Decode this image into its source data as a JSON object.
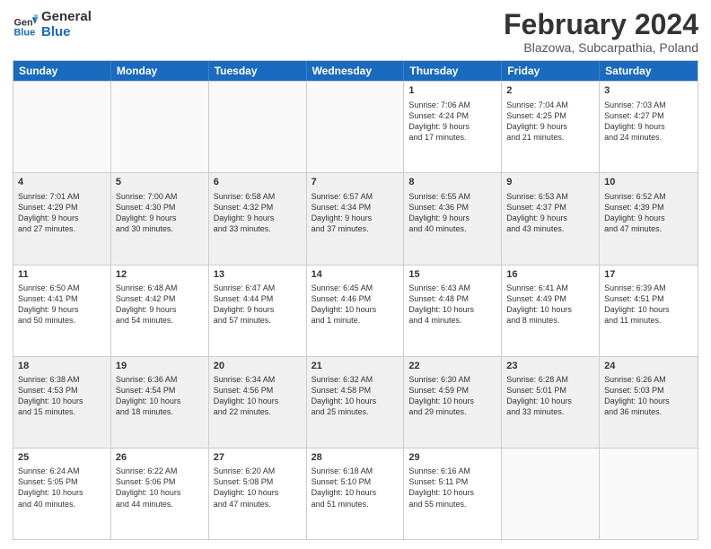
{
  "logo": {
    "line1": "General",
    "line2": "Blue"
  },
  "title": "February 2024",
  "subtitle": "Blazowa, Subcarpathia, Poland",
  "days": [
    "Sunday",
    "Monday",
    "Tuesday",
    "Wednesday",
    "Thursday",
    "Friday",
    "Saturday"
  ],
  "rows": [
    [
      {
        "day": "",
        "lines": []
      },
      {
        "day": "",
        "lines": []
      },
      {
        "day": "",
        "lines": []
      },
      {
        "day": "",
        "lines": []
      },
      {
        "day": "1",
        "lines": [
          "Sunrise: 7:06 AM",
          "Sunset: 4:24 PM",
          "Daylight: 9 hours",
          "and 17 minutes."
        ]
      },
      {
        "day": "2",
        "lines": [
          "Sunrise: 7:04 AM",
          "Sunset: 4:25 PM",
          "Daylight: 9 hours",
          "and 21 minutes."
        ]
      },
      {
        "day": "3",
        "lines": [
          "Sunrise: 7:03 AM",
          "Sunset: 4:27 PM",
          "Daylight: 9 hours",
          "and 24 minutes."
        ]
      }
    ],
    [
      {
        "day": "4",
        "lines": [
          "Sunrise: 7:01 AM",
          "Sunset: 4:29 PM",
          "Daylight: 9 hours",
          "and 27 minutes."
        ]
      },
      {
        "day": "5",
        "lines": [
          "Sunrise: 7:00 AM",
          "Sunset: 4:30 PM",
          "Daylight: 9 hours",
          "and 30 minutes."
        ]
      },
      {
        "day": "6",
        "lines": [
          "Sunrise: 6:58 AM",
          "Sunset: 4:32 PM",
          "Daylight: 9 hours",
          "and 33 minutes."
        ]
      },
      {
        "day": "7",
        "lines": [
          "Sunrise: 6:57 AM",
          "Sunset: 4:34 PM",
          "Daylight: 9 hours",
          "and 37 minutes."
        ]
      },
      {
        "day": "8",
        "lines": [
          "Sunrise: 6:55 AM",
          "Sunset: 4:36 PM",
          "Daylight: 9 hours",
          "and 40 minutes."
        ]
      },
      {
        "day": "9",
        "lines": [
          "Sunrise: 6:53 AM",
          "Sunset: 4:37 PM",
          "Daylight: 9 hours",
          "and 43 minutes."
        ]
      },
      {
        "day": "10",
        "lines": [
          "Sunrise: 6:52 AM",
          "Sunset: 4:39 PM",
          "Daylight: 9 hours",
          "and 47 minutes."
        ]
      }
    ],
    [
      {
        "day": "11",
        "lines": [
          "Sunrise: 6:50 AM",
          "Sunset: 4:41 PM",
          "Daylight: 9 hours",
          "and 50 minutes."
        ]
      },
      {
        "day": "12",
        "lines": [
          "Sunrise: 6:48 AM",
          "Sunset: 4:42 PM",
          "Daylight: 9 hours",
          "and 54 minutes."
        ]
      },
      {
        "day": "13",
        "lines": [
          "Sunrise: 6:47 AM",
          "Sunset: 4:44 PM",
          "Daylight: 9 hours",
          "and 57 minutes."
        ]
      },
      {
        "day": "14",
        "lines": [
          "Sunrise: 6:45 AM",
          "Sunset: 4:46 PM",
          "Daylight: 10 hours",
          "and 1 minute."
        ]
      },
      {
        "day": "15",
        "lines": [
          "Sunrise: 6:43 AM",
          "Sunset: 4:48 PM",
          "Daylight: 10 hours",
          "and 4 minutes."
        ]
      },
      {
        "day": "16",
        "lines": [
          "Sunrise: 6:41 AM",
          "Sunset: 4:49 PM",
          "Daylight: 10 hours",
          "and 8 minutes."
        ]
      },
      {
        "day": "17",
        "lines": [
          "Sunrise: 6:39 AM",
          "Sunset: 4:51 PM",
          "Daylight: 10 hours",
          "and 11 minutes."
        ]
      }
    ],
    [
      {
        "day": "18",
        "lines": [
          "Sunrise: 6:38 AM",
          "Sunset: 4:53 PM",
          "Daylight: 10 hours",
          "and 15 minutes."
        ]
      },
      {
        "day": "19",
        "lines": [
          "Sunrise: 6:36 AM",
          "Sunset: 4:54 PM",
          "Daylight: 10 hours",
          "and 18 minutes."
        ]
      },
      {
        "day": "20",
        "lines": [
          "Sunrise: 6:34 AM",
          "Sunset: 4:56 PM",
          "Daylight: 10 hours",
          "and 22 minutes."
        ]
      },
      {
        "day": "21",
        "lines": [
          "Sunrise: 6:32 AM",
          "Sunset: 4:58 PM",
          "Daylight: 10 hours",
          "and 25 minutes."
        ]
      },
      {
        "day": "22",
        "lines": [
          "Sunrise: 6:30 AM",
          "Sunset: 4:59 PM",
          "Daylight: 10 hours",
          "and 29 minutes."
        ]
      },
      {
        "day": "23",
        "lines": [
          "Sunrise: 6:28 AM",
          "Sunset: 5:01 PM",
          "Daylight: 10 hours",
          "and 33 minutes."
        ]
      },
      {
        "day": "24",
        "lines": [
          "Sunrise: 6:26 AM",
          "Sunset: 5:03 PM",
          "Daylight: 10 hours",
          "and 36 minutes."
        ]
      }
    ],
    [
      {
        "day": "25",
        "lines": [
          "Sunrise: 6:24 AM",
          "Sunset: 5:05 PM",
          "Daylight: 10 hours",
          "and 40 minutes."
        ]
      },
      {
        "day": "26",
        "lines": [
          "Sunrise: 6:22 AM",
          "Sunset: 5:06 PM",
          "Daylight: 10 hours",
          "and 44 minutes."
        ]
      },
      {
        "day": "27",
        "lines": [
          "Sunrise: 6:20 AM",
          "Sunset: 5:08 PM",
          "Daylight: 10 hours",
          "and 47 minutes."
        ]
      },
      {
        "day": "28",
        "lines": [
          "Sunrise: 6:18 AM",
          "Sunset: 5:10 PM",
          "Daylight: 10 hours",
          "and 51 minutes."
        ]
      },
      {
        "day": "29",
        "lines": [
          "Sunrise: 6:16 AM",
          "Sunset: 5:11 PM",
          "Daylight: 10 hours",
          "and 55 minutes."
        ]
      },
      {
        "day": "",
        "lines": []
      },
      {
        "day": "",
        "lines": []
      }
    ]
  ]
}
